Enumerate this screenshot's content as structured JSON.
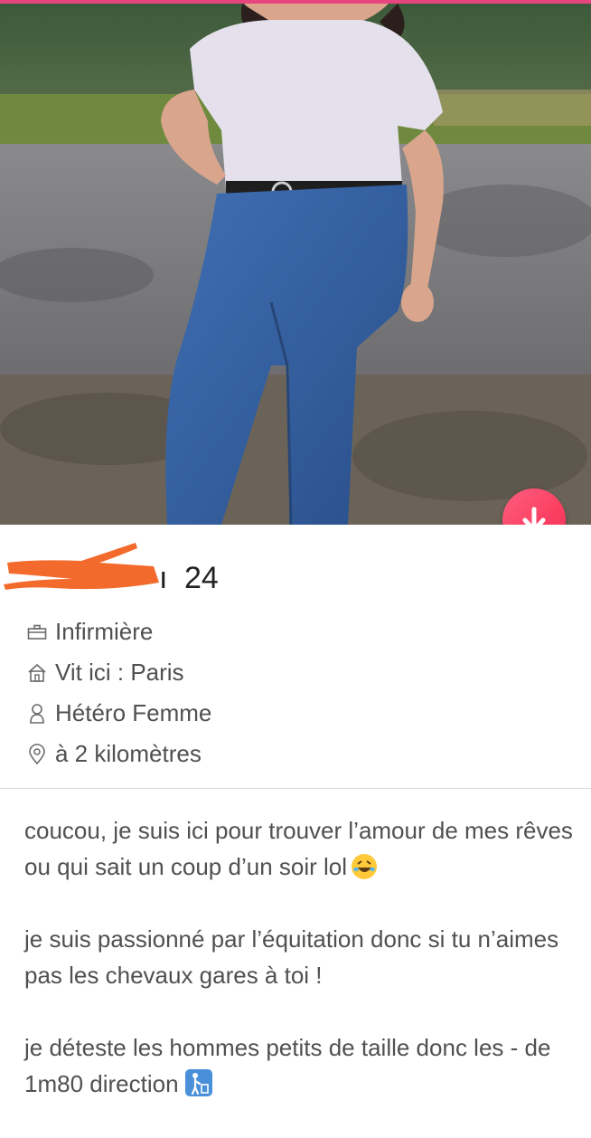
{
  "profile": {
    "age": "24",
    "name_suffix": "ı",
    "details": [
      {
        "icon": "briefcase-icon",
        "text": "Infirmière"
      },
      {
        "icon": "house-icon",
        "text": "Vit ici : Paris"
      },
      {
        "icon": "person-icon",
        "text": "Hétéro Femme"
      },
      {
        "icon": "location-pin-icon",
        "text": "à 2 kilomètres"
      }
    ]
  },
  "bio": {
    "p1": "coucou, je suis ici pour trouver l’amour de mes rêves ou qui sait un coup d’un soir lol",
    "p2": "je suis passionné par l’équitation donc si tu n’aimes pas les chevaux gares à toi !",
    "p3": "je déteste les hommes petits de taille donc les - de 1m80 direction"
  },
  "colors": {
    "accent": "#fd4f70",
    "redaction": "#f26a2c"
  },
  "controls": {
    "collapse_icon": "arrow-down-icon"
  }
}
